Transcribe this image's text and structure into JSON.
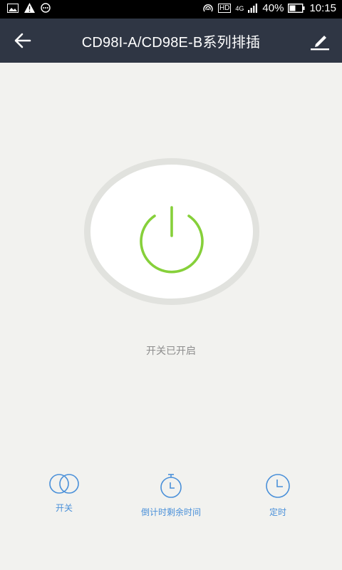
{
  "status_bar": {
    "battery_text": "40%",
    "time": "10:15",
    "network": "4G",
    "hd": "HD"
  },
  "app_bar": {
    "title": "CD98I-A/CD98E-B系列排插"
  },
  "main": {
    "power_status": "开关已开启"
  },
  "bottom_actions": [
    {
      "label": "开关",
      "icon": "toggle-icon"
    },
    {
      "label": "倒计时剩余时间",
      "icon": "stopwatch-icon"
    },
    {
      "label": "定时",
      "icon": "clock-icon"
    }
  ],
  "colors": {
    "app_bar": "#2f3644",
    "power_on": "#86d03a",
    "accent_blue": "#4a90d9",
    "background": "#f2f2ef"
  }
}
